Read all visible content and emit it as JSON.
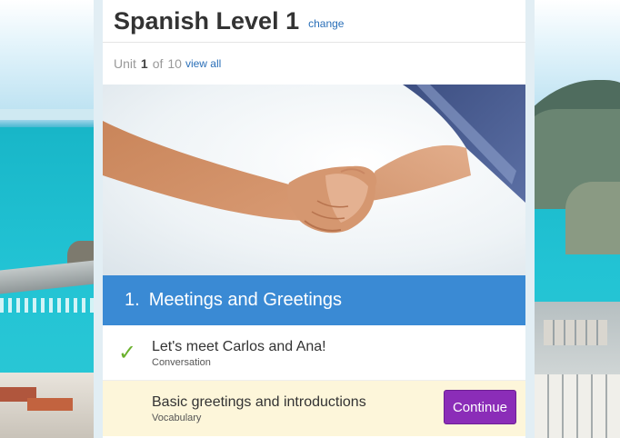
{
  "course": {
    "title": "Spanish Level 1",
    "change_label": "change"
  },
  "unit_nav": {
    "prefix": "Unit",
    "current": "1",
    "of_label": "of",
    "total": "10",
    "view_all_label": "view all"
  },
  "unit": {
    "number": "1.",
    "title": "Meetings and Greetings",
    "banner_color": "#3a8ad4"
  },
  "lessons": [
    {
      "title": "Let's meet Carlos and Ana!",
      "type": "Conversation",
      "status": "completed",
      "icon": "check-icon"
    },
    {
      "title": "Basic greetings and introductions",
      "type": "Vocabulary",
      "status": "current",
      "action_label": "Continue"
    }
  ],
  "colors": {
    "accent_button": "#8b2db8",
    "link": "#2a6fb8",
    "check": "#6bb12d",
    "active_row": "#fdf6da"
  }
}
